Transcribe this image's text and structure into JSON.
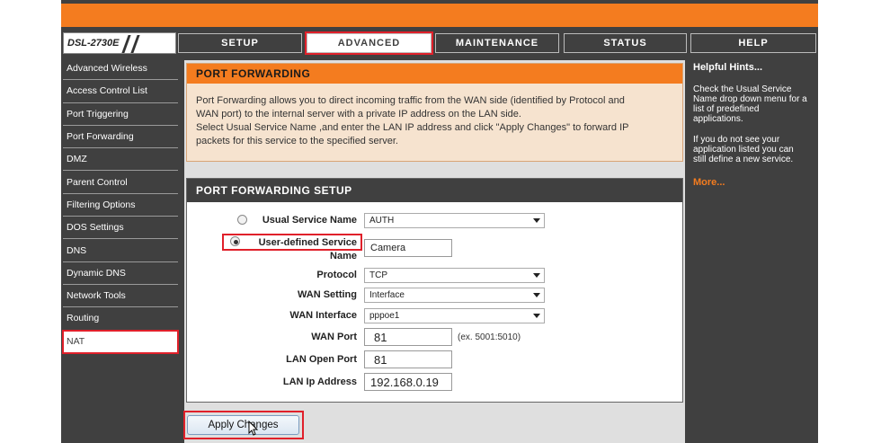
{
  "logo": {
    "model": "DSL-2730E"
  },
  "tabs": [
    {
      "label": "SETUP"
    },
    {
      "label": "ADVANCED"
    },
    {
      "label": "MAINTENANCE"
    },
    {
      "label": "STATUS"
    },
    {
      "label": "HELP"
    }
  ],
  "sidebar": {
    "items": [
      {
        "label": "Advanced Wireless"
      },
      {
        "label": "Access Control List"
      },
      {
        "label": "Port Triggering"
      },
      {
        "label": "Port Forwarding"
      },
      {
        "label": "DMZ"
      },
      {
        "label": "Parent Control"
      },
      {
        "label": "Filtering Options"
      },
      {
        "label": "DOS Settings"
      },
      {
        "label": "DNS"
      },
      {
        "label": "Dynamic DNS"
      },
      {
        "label": "Network Tools"
      },
      {
        "label": "Routing"
      },
      {
        "label": "NAT"
      }
    ]
  },
  "intro": {
    "title": "PORT FORWARDING",
    "text1": "Port Forwarding allows you to direct incoming traffic from the WAN side (identified by Protocol and",
    "text2": "WAN port) to the internal server with a private IP address on the LAN side.",
    "text3": "Select Usual Service Name ,and enter the LAN IP address and click \"Apply Changes\" to forward IP",
    "text4": "packets for this service to the specified server."
  },
  "setup": {
    "title": "PORT FORWARDING SETUP",
    "usual_service_label": "Usual Service Name",
    "usual_service_value": "AUTH",
    "user_defined_label1": "User-defined Service",
    "user_defined_label2": "Name",
    "user_defined_value": "Camera",
    "protocol_label": "Protocol",
    "protocol_value": "TCP",
    "wan_setting_label": "WAN Setting",
    "wan_setting_value": "Interface",
    "wan_interface_label": "WAN Interface",
    "wan_interface_value": "pppoe1",
    "wan_port_label": "WAN Port",
    "wan_port_value": "81",
    "wan_port_example": "(ex. 5001:5010)",
    "lan_open_port_label": "LAN Open Port",
    "lan_open_port_value": "81",
    "lan_ip_label": "LAN Ip Address",
    "lan_ip_value": "192.168.0.19"
  },
  "apply_button": "Apply Changes",
  "hints": {
    "title": "Helpful Hints...",
    "p1": [
      "Check the Usual Service",
      "Name drop down menu for a",
      "list of predefined",
      "applications."
    ],
    "p2": [
      "If you do not see your",
      "application listed you can",
      "still define a new service."
    ],
    "more": "More..."
  },
  "colors": {
    "brand_orange": "#f47c1f",
    "highlight_red": "#e0202a",
    "dark_gray": "#404040"
  }
}
